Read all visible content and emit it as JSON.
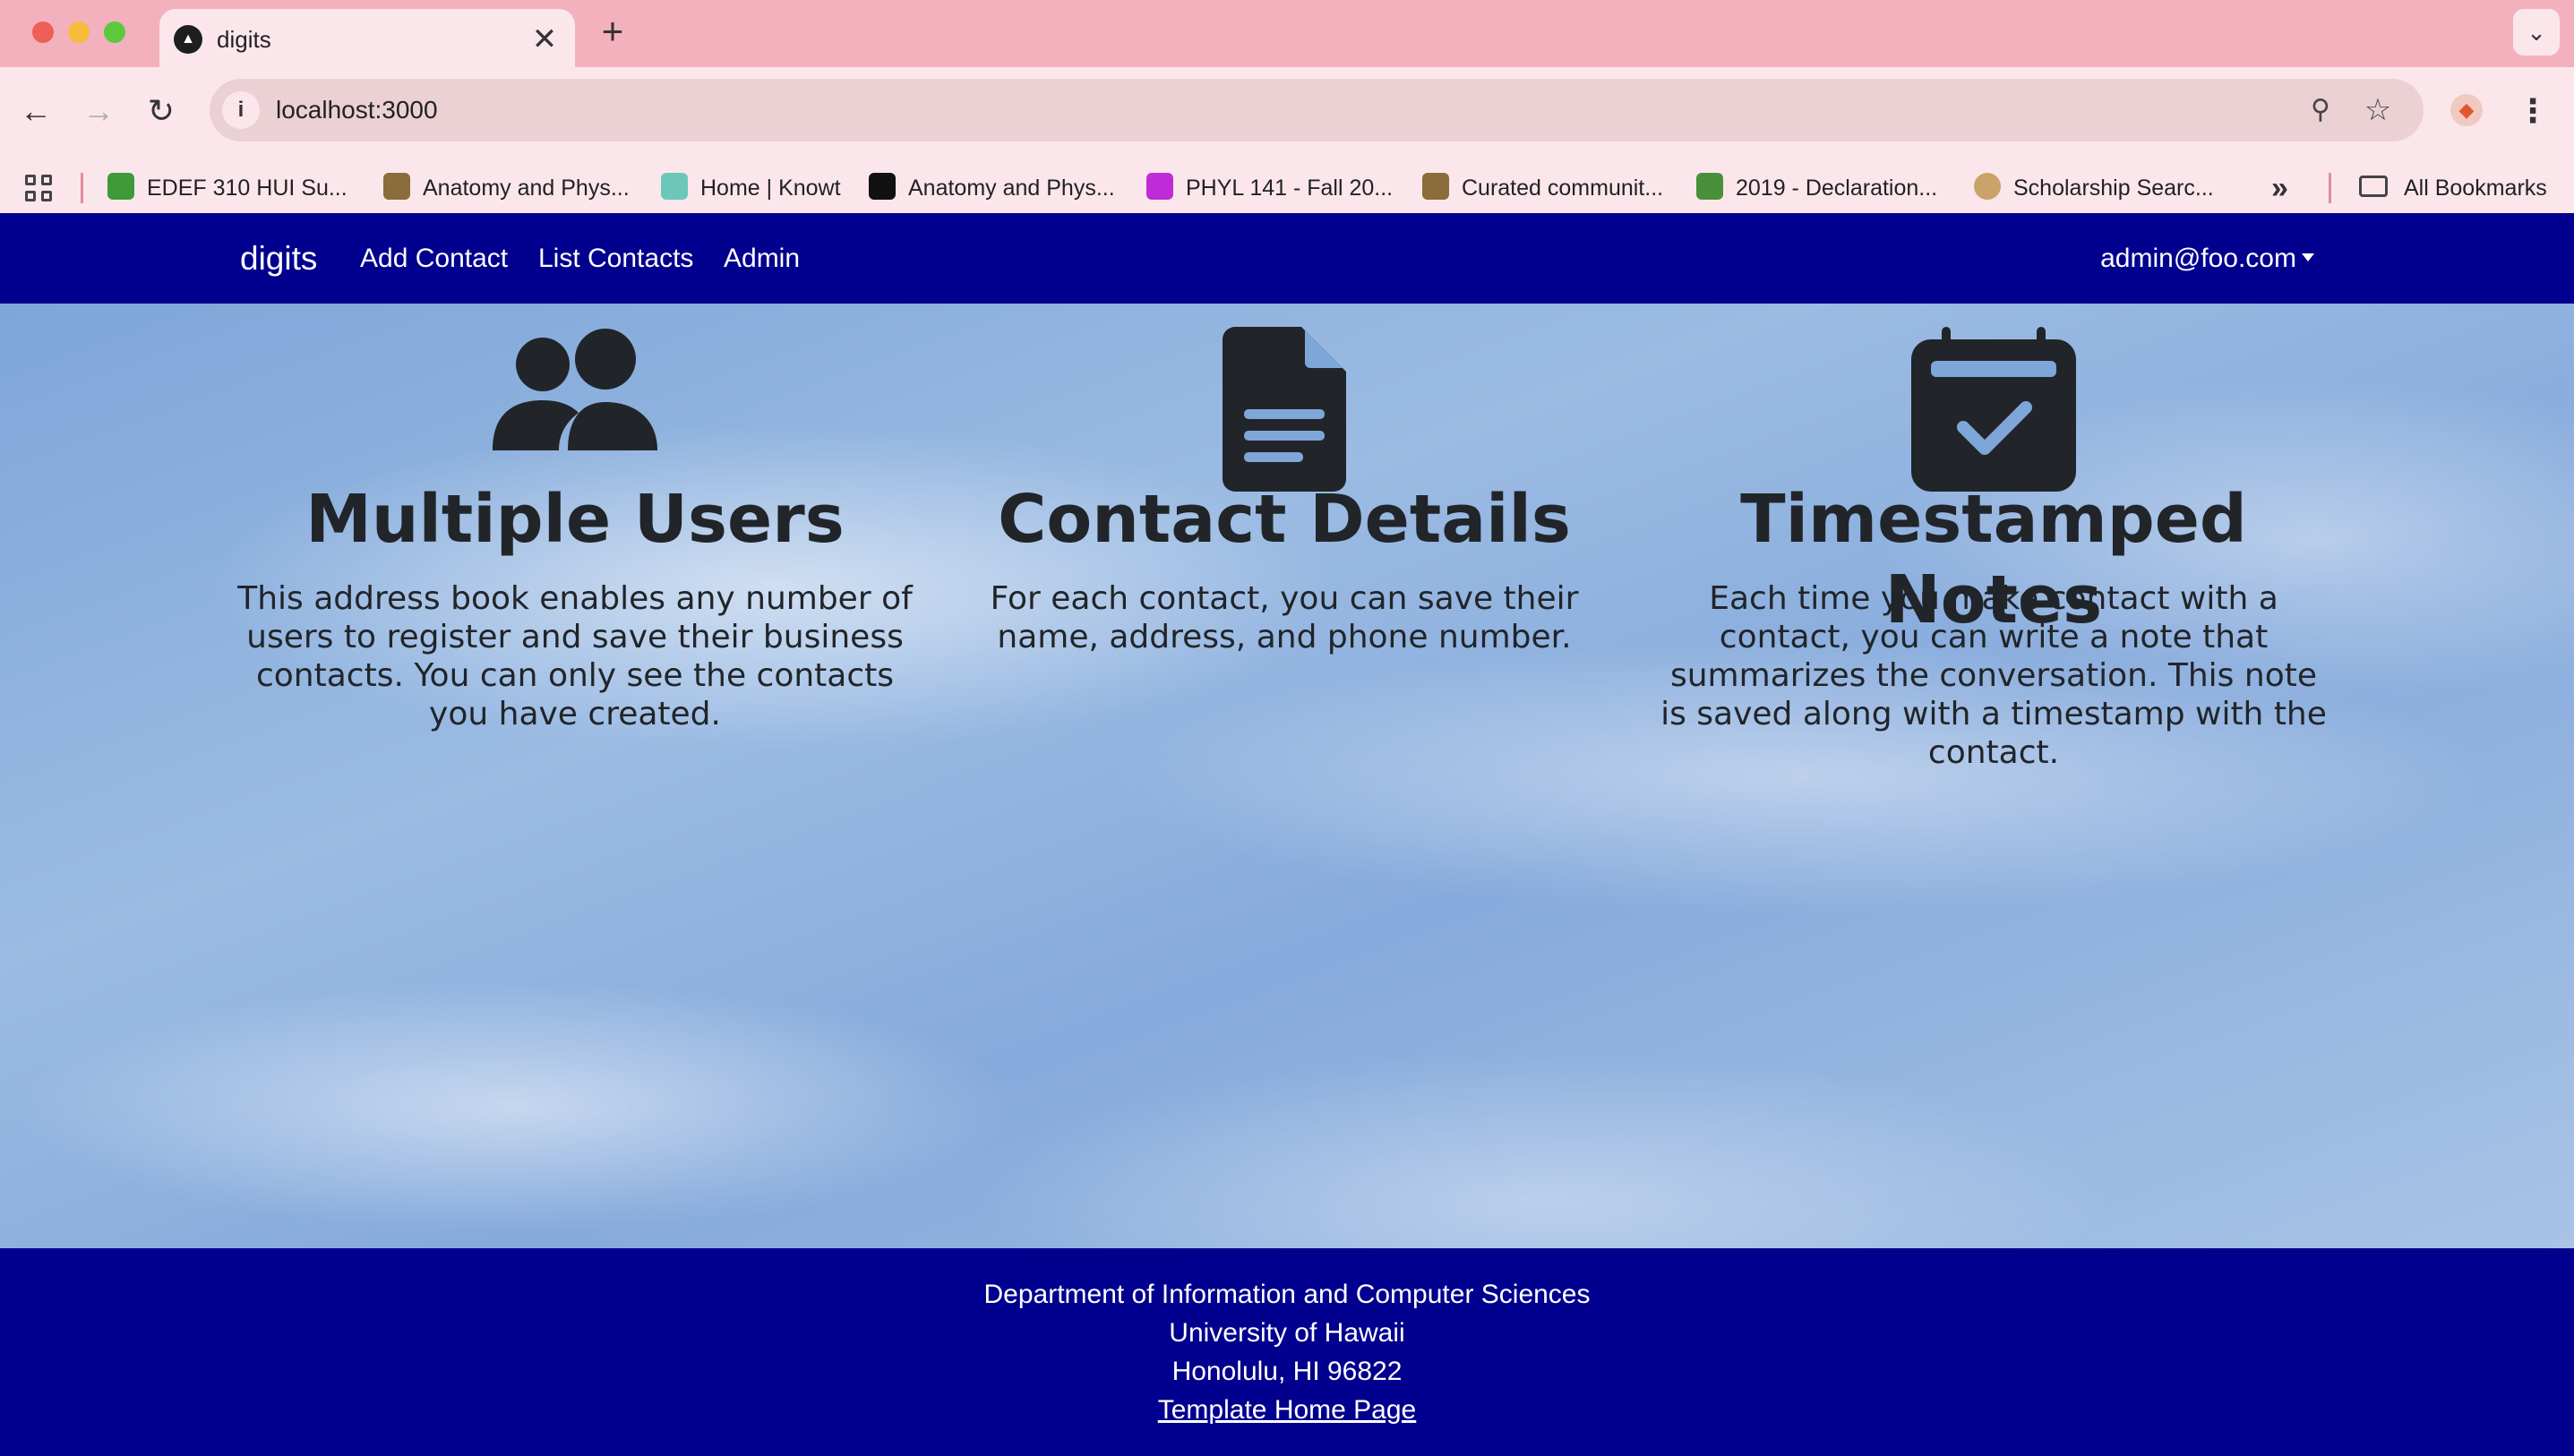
{
  "browser": {
    "tab_title": "digits",
    "tab_close": "✕",
    "new_tab": "+",
    "url": "localhost:3000",
    "bookmarks": [
      {
        "label": "EDEF 310 HUI Su...",
        "icon": "leaf-icon",
        "color": "#3f9a3a"
      },
      {
        "label": "Anatomy and Phys...",
        "icon": "books-icon",
        "color": "#8a6d3b"
      },
      {
        "label": "Home | Knowt",
        "icon": "knowt-icon",
        "color": "#6cc7b8"
      },
      {
        "label": "Anatomy and Phys...",
        "icon": "square-logo-icon",
        "color": "#111111"
      },
      {
        "label": "PHYL 141 - Fall 20...",
        "icon": "t-logo-icon",
        "color": "#c02bd8"
      },
      {
        "label": "Curated communit...",
        "icon": "books-icon",
        "color": "#8a6d3b"
      },
      {
        "label": "2019 - Declaration...",
        "icon": "natsci-icon",
        "color": "#4a8f3a"
      },
      {
        "label": "Scholarship Searc...",
        "icon": "seal-icon",
        "color": "#c9a36a"
      }
    ],
    "more_bookmarks": "»",
    "all_bookmarks": "All Bookmarks"
  },
  "navbar": {
    "brand": "digits",
    "links": [
      "Add Contact",
      "List Contacts",
      "Admin"
    ],
    "user": "admin@foo.com"
  },
  "features": [
    {
      "icon": "users-icon",
      "title": "Multiple Users",
      "text": "This address book enables any number of users to register and save their business contacts. You can only see the contacts you have created."
    },
    {
      "icon": "file-text-icon",
      "title": "Contact Details",
      "text": "For each contact, you can save their name, address, and phone number."
    },
    {
      "icon": "calendar-check-icon",
      "title": "Timestamped Notes",
      "text": "Each time you make contact with a contact, you can write a note that summarizes the conversation. This note is saved along with a timestamp with the contact."
    }
  ],
  "footer": {
    "line1": "Department of Information and Computer Sciences",
    "line2": "University of Hawaii",
    "line3": "Honolulu, HI 96822",
    "link": "Template Home Page"
  },
  "colors": {
    "navbar": "#02008e",
    "icon_dark": "#212529",
    "tab_strip": "#f3b1bd"
  }
}
